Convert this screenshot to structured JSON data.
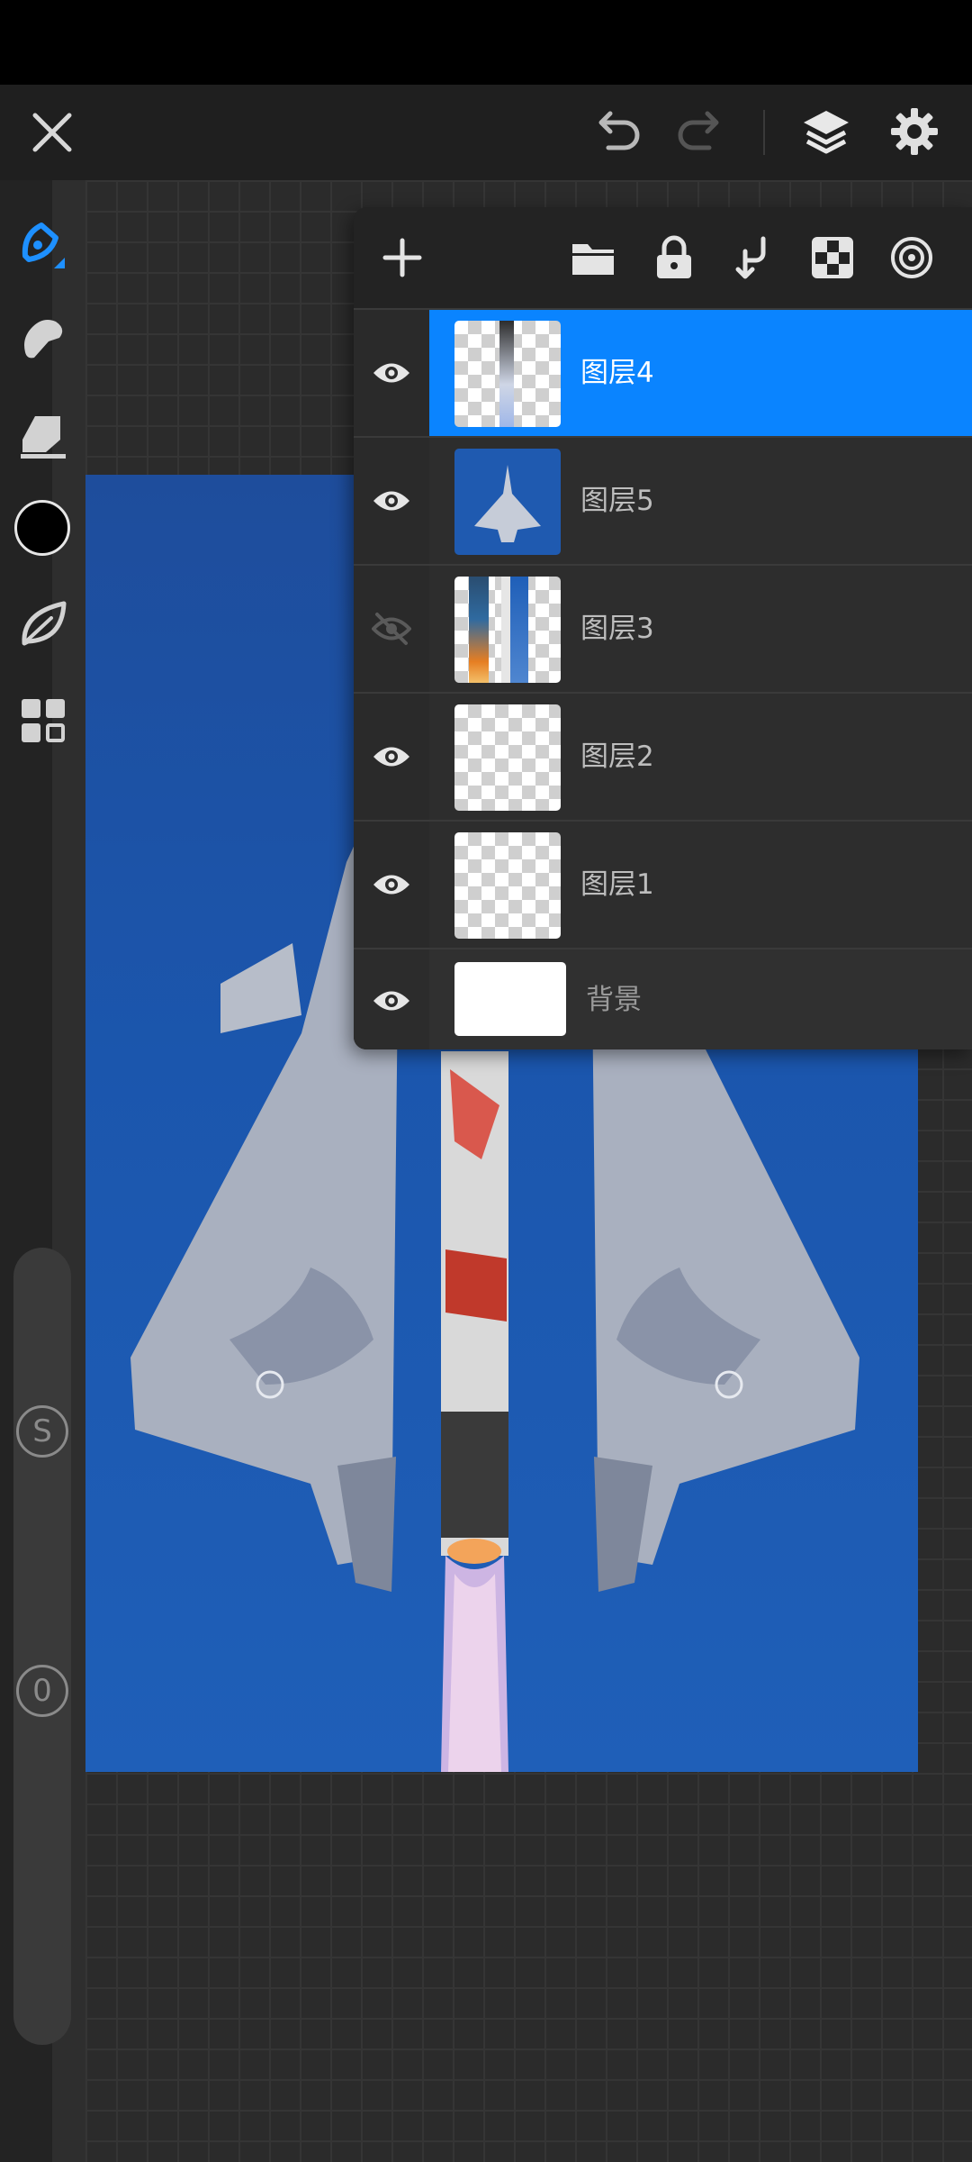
{
  "toolbar": {
    "close_icon": "close-icon",
    "undo_icon": "undo-icon",
    "redo_icon": "redo-icon",
    "layers_icon": "layers-icon",
    "settings_icon": "gear-icon"
  },
  "tools": [
    "brush-icon",
    "smudge-icon",
    "eraser-icon",
    "color-swatch",
    "leaf-icon",
    "gallery-grid-icon"
  ],
  "rail": {
    "size_knob_label": "S",
    "opacity_knob_label": "0"
  },
  "layers_panel": {
    "toolbar_icons": [
      "add-icon",
      "folder-icon",
      "lock-icon",
      "merge-down-icon",
      "checkerboard-icon",
      "target-icon"
    ],
    "layers": [
      {
        "name": "图层4",
        "visible": true,
        "selected": true
      },
      {
        "name": "图层5",
        "visible": true,
        "selected": false
      },
      {
        "name": "图层3",
        "visible": false,
        "selected": false
      },
      {
        "name": "图层2",
        "visible": true,
        "selected": false
      },
      {
        "name": "图层1",
        "visible": true,
        "selected": false
      }
    ],
    "background_layer": {
      "name": "背景",
      "visible": true
    }
  },
  "colors": {
    "accent": "#0a84ff",
    "current_color": "#000000",
    "sky_blue": "#1e55a8"
  }
}
